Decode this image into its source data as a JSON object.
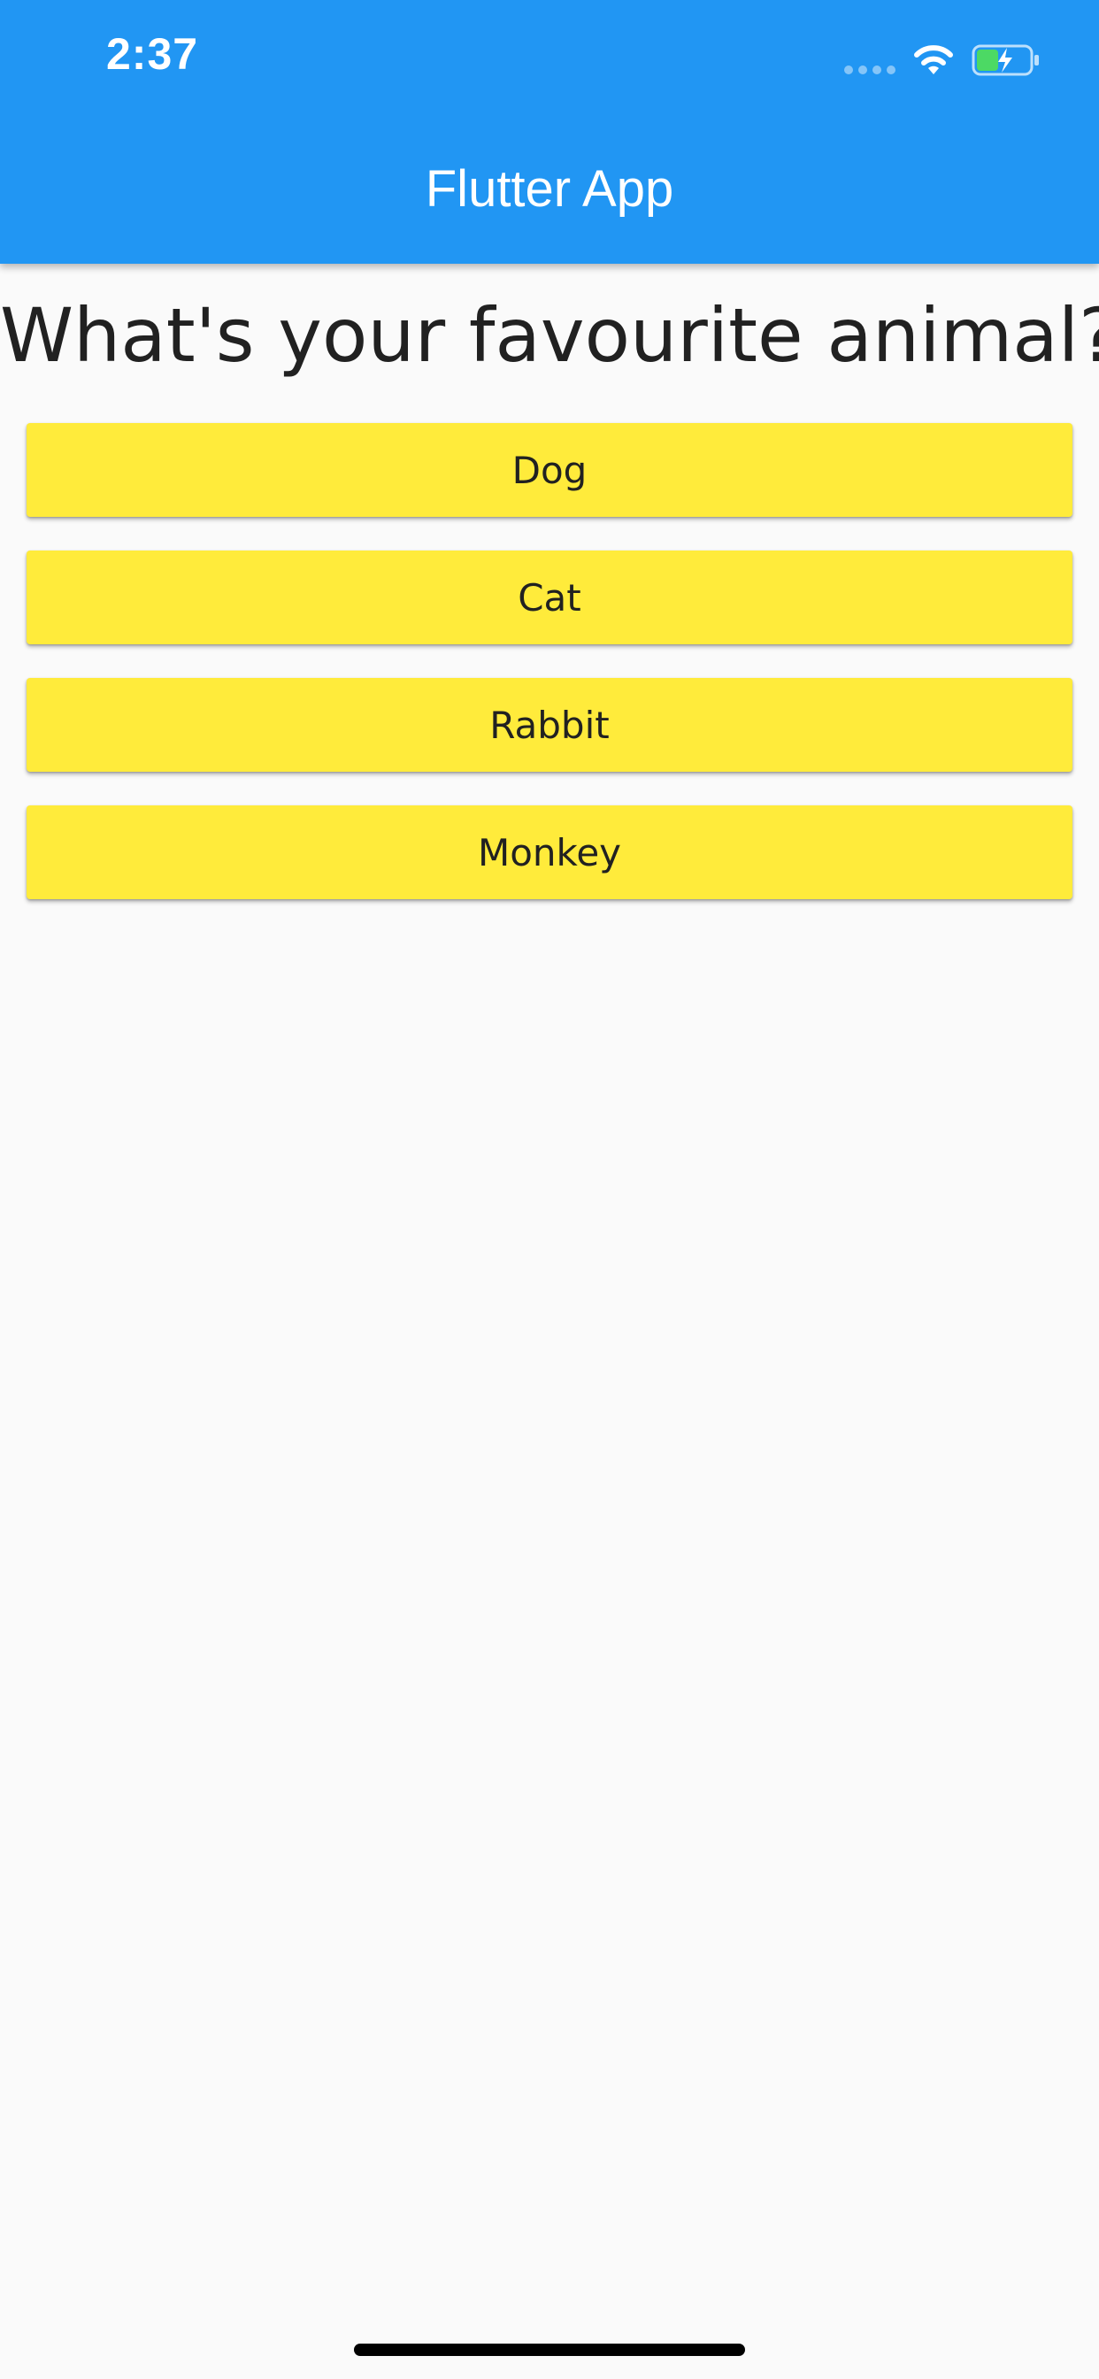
{
  "status_bar": {
    "time": "2:37"
  },
  "app_bar": {
    "title": "Flutter App"
  },
  "question": {
    "text": "What's your favourite animal?"
  },
  "answers": [
    {
      "label": "Dog"
    },
    {
      "label": "Cat"
    },
    {
      "label": "Rabbit"
    },
    {
      "label": "Monkey"
    }
  ],
  "colors": {
    "app_bar": "#2196f3",
    "button": "#ffeb3b",
    "background": "#fafafa",
    "battery_fill": "#4cd964"
  },
  "icons": {
    "signal": "cellular-signal-icon",
    "wifi": "wifi-icon",
    "battery": "battery-charging-icon"
  }
}
